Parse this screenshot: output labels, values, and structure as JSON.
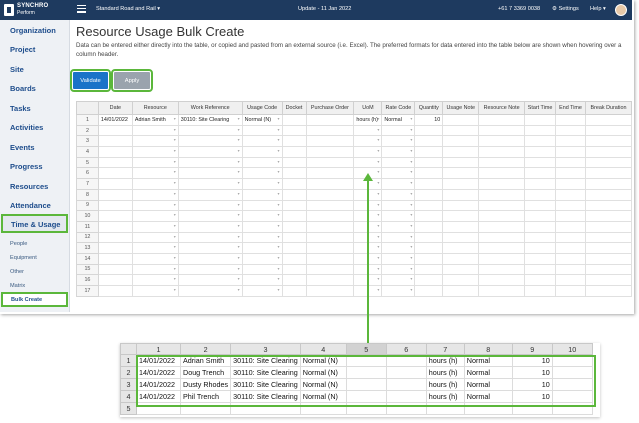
{
  "topbar": {
    "logo_line1": "SYNCHRO",
    "logo_line2": "Perform",
    "project": "Standard Road and Rail ▾",
    "update": "Update - 11 Jan 2022",
    "phone": "+61 7 3369 0038",
    "settings": "⚙ Settings",
    "help": "Help ▾"
  },
  "sidebar": {
    "items": [
      "Organization",
      "Project",
      "Site",
      "Boards",
      "Tasks",
      "Activities",
      "Events",
      "Progress",
      "Resources",
      "Attendance"
    ],
    "active": "Time & Usage",
    "subitems": [
      "People",
      "Equipment",
      "Other",
      "Matrix"
    ],
    "sub_active": "Bulk Create"
  },
  "page": {
    "title": "Resource Usage Bulk Create",
    "description": "Data can be entered either directly into the table, or copied and pasted from an external source (i.e. Excel). The preferred formats for data entered into the table below are shown when hovering over a column header.",
    "validate_label": "Validate",
    "apply_label": "Apply"
  },
  "grid": {
    "headers": [
      "",
      "Date",
      "Resource",
      "Work Reference",
      "Usage Code",
      "Docket",
      "Purchase Order",
      "UoM",
      "Rate Code",
      "Quantity",
      "Usage Note",
      "Resource Note",
      "Start Time",
      "End Time",
      "Break Duration"
    ],
    "rows": [
      [
        "1",
        "14/01/2022",
        "Adrian Smith",
        "30110: Site Clearing",
        "Normal (N)",
        "",
        "",
        "hours (h)",
        "Normal",
        "10",
        "",
        "",
        "",
        "",
        ""
      ],
      [
        "2",
        "",
        "",
        "",
        "",
        "",
        "",
        "",
        "",
        "",
        "",
        "",
        "",
        "",
        ""
      ],
      [
        "3",
        "",
        "",
        "",
        "",
        "",
        "",
        "",
        "",
        "",
        "",
        "",
        "",
        "",
        ""
      ],
      [
        "4",
        "",
        "",
        "",
        "",
        "",
        "",
        "",
        "",
        "",
        "",
        "",
        "",
        "",
        ""
      ],
      [
        "5",
        "",
        "",
        "",
        "",
        "",
        "",
        "",
        "",
        "",
        "",
        "",
        "",
        "",
        ""
      ],
      [
        "6",
        "",
        "",
        "",
        "",
        "",
        "",
        "",
        "",
        "",
        "",
        "",
        "",
        "",
        ""
      ],
      [
        "7",
        "",
        "",
        "",
        "",
        "",
        "",
        "",
        "",
        "",
        "",
        "",
        "",
        "",
        ""
      ],
      [
        "8",
        "",
        "",
        "",
        "",
        "",
        "",
        "",
        "",
        "",
        "",
        "",
        "",
        "",
        ""
      ],
      [
        "9",
        "",
        "",
        "",
        "",
        "",
        "",
        "",
        "",
        "",
        "",
        "",
        "",
        "",
        ""
      ],
      [
        "10",
        "",
        "",
        "",
        "",
        "",
        "",
        "",
        "",
        "",
        "",
        "",
        "",
        "",
        ""
      ],
      [
        "11",
        "",
        "",
        "",
        "",
        "",
        "",
        "",
        "",
        "",
        "",
        "",
        "",
        "",
        ""
      ],
      [
        "12",
        "",
        "",
        "",
        "",
        "",
        "",
        "",
        "",
        "",
        "",
        "",
        "",
        "",
        ""
      ],
      [
        "13",
        "",
        "",
        "",
        "",
        "",
        "",
        "",
        "",
        "",
        "",
        "",
        "",
        "",
        ""
      ],
      [
        "14",
        "",
        "",
        "",
        "",
        "",
        "",
        "",
        "",
        "",
        "",
        "",
        "",
        "",
        ""
      ],
      [
        "15",
        "",
        "",
        "",
        "",
        "",
        "",
        "",
        "",
        "",
        "",
        "",
        "",
        "",
        ""
      ],
      [
        "16",
        "",
        "",
        "",
        "",
        "",
        "",
        "",
        "",
        "",
        "",
        "",
        "",
        "",
        ""
      ],
      [
        "17",
        "",
        "",
        "",
        "",
        "",
        "",
        "",
        "",
        "",
        "",
        "",
        "",
        "",
        ""
      ]
    ]
  },
  "excel": {
    "headers": [
      "",
      "1",
      "2",
      "3",
      "4",
      "5",
      "6",
      "7",
      "8",
      "9",
      "10"
    ],
    "rows": [
      [
        "1",
        "14/01/2022",
        "Adrian Smith",
        "30110: Site Clearing",
        "Normal (N)",
        "",
        "",
        "hours (h)",
        "Normal",
        "10",
        ""
      ],
      [
        "2",
        "14/01/2022",
        "Doug Trench",
        "30110: Site Clearing",
        "Normal (N)",
        "",
        "",
        "hours (h)",
        "Normal",
        "10",
        ""
      ],
      [
        "3",
        "14/01/2022",
        "Dusty Rhodes",
        "30110: Site Clearing",
        "Normal (N)",
        "",
        "",
        "hours (h)",
        "Normal",
        "10",
        ""
      ],
      [
        "4",
        "14/01/2022",
        "Phil Trench",
        "30110: Site Clearing",
        "Normal (N)",
        "",
        "",
        "hours (h)",
        "Normal",
        "10",
        ""
      ],
      [
        "5",
        "",
        "",
        "",
        "",
        "",
        "",
        "",
        "",
        "",
        ""
      ]
    ]
  },
  "colors": {
    "topbar": "#1e3a5f",
    "accent_green": "#5bb73b",
    "validate_blue": "#1a73c8",
    "apply_grey": "#9aa3ad",
    "nav_text": "#1e4d8c"
  },
  "icons": [
    "hamburger-icon",
    "gear-icon",
    "avatar"
  ]
}
